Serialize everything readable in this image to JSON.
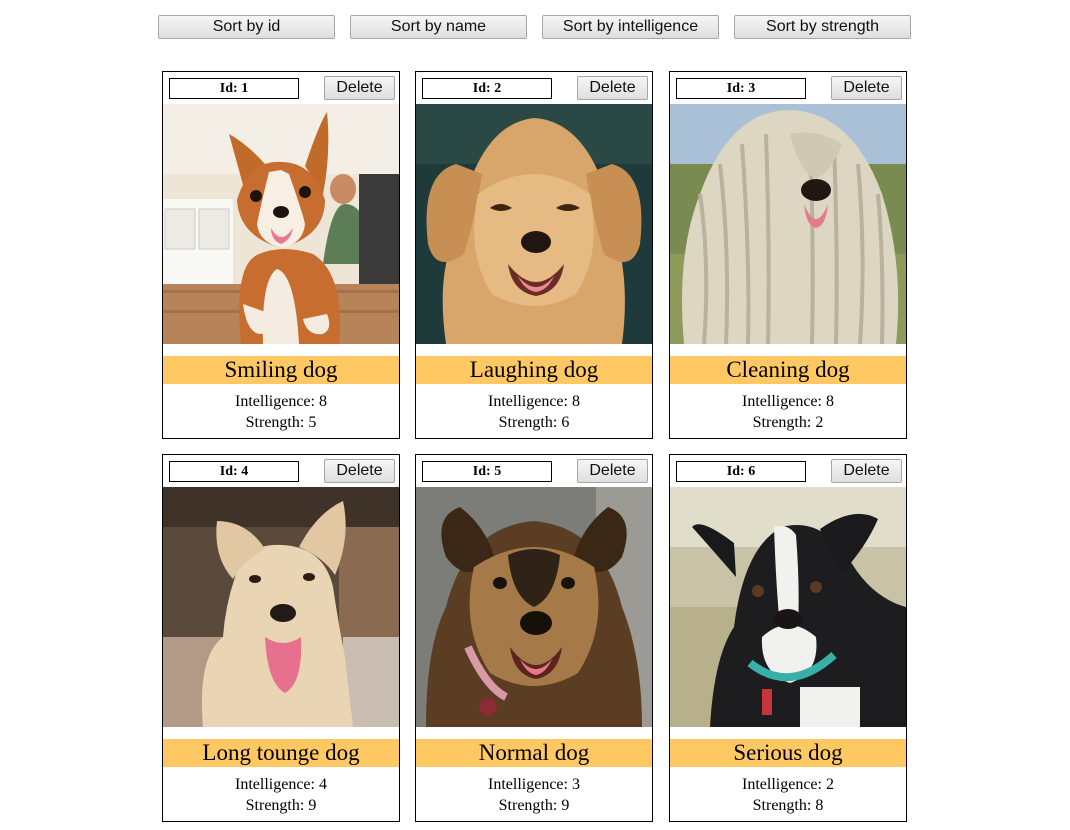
{
  "sort_buttons": {
    "by_id": "Sort by id",
    "by_name": "Sort by name",
    "by_intelligence": "Sort by intelligence",
    "by_strength": "Sort by strength"
  },
  "dogs": [
    {
      "id_label": "Id: 1",
      "delete_label": "Delete",
      "name": "Smiling dog",
      "intelligence": "Intelligence: 8",
      "strength": "Strength: 5",
      "photo_desc": "corgi puppy in kitchen"
    },
    {
      "id_label": "Id: 2",
      "delete_label": "Delete",
      "name": "Laughing dog",
      "intelligence": "Intelligence: 8",
      "strength": "Strength: 6",
      "photo_desc": "golden puppy smiling"
    },
    {
      "id_label": "Id: 3",
      "delete_label": "Delete",
      "name": "Cleaning dog",
      "intelligence": "Intelligence: 8",
      "strength": "Strength: 2",
      "photo_desc": "corded white komondor"
    },
    {
      "id_label": "Id: 4",
      "delete_label": "Delete",
      "name": "Long tounge dog",
      "intelligence": "Intelligence: 4",
      "strength": "Strength: 9",
      "photo_desc": "cream dog with long tongue"
    },
    {
      "id_label": "Id: 5",
      "delete_label": "Delete",
      "name": "Normal dog",
      "intelligence": "Intelligence: 3",
      "strength": "Strength: 9",
      "photo_desc": "brown shepherd mix"
    },
    {
      "id_label": "Id: 6",
      "delete_label": "Delete",
      "name": "Serious dog",
      "intelligence": "Intelligence: 2",
      "strength": "Strength: 8",
      "photo_desc": "black and white dog with collar"
    }
  ]
}
